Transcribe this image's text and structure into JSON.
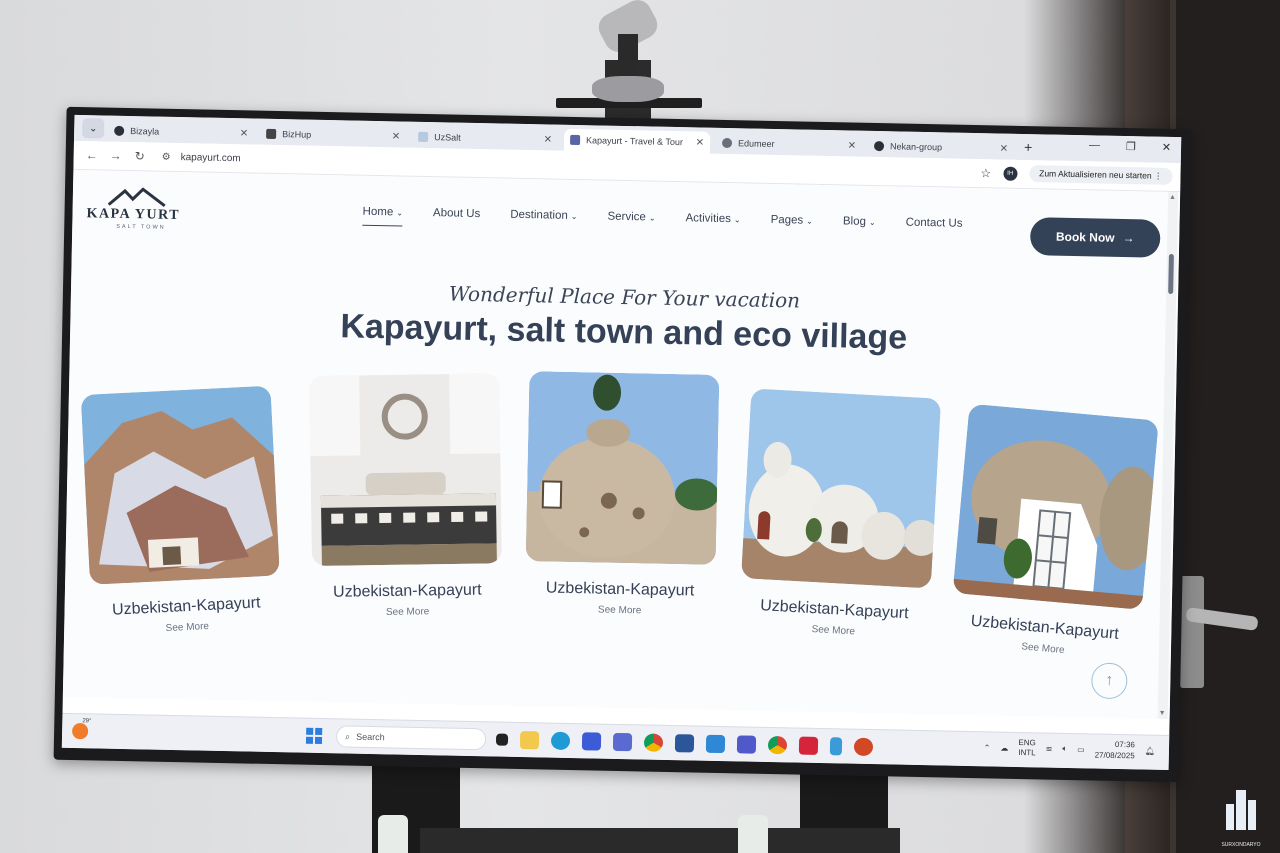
{
  "browser": {
    "tabs": [
      {
        "label": "Bizayla",
        "favicon": "bizayla-icon",
        "active": false
      },
      {
        "label": "BizHup",
        "favicon": "bizhup-icon",
        "active": false
      },
      {
        "label": "UzSalt",
        "favicon": "uzsalt-icon",
        "active": false
      },
      {
        "label": "Kapayurt - Travel & Tour",
        "favicon": "kapayurt-icon",
        "active": true
      },
      {
        "label": "Edumeer",
        "favicon": "globe-icon",
        "active": false
      },
      {
        "label": "Nekan-group",
        "favicon": "nekan-icon",
        "active": false
      }
    ],
    "url": "kapayurt.com",
    "update_button": "Zum Aktualisieren neu starten",
    "profile_badge": "IH"
  },
  "site": {
    "logo": {
      "name": "KAPA YURT",
      "sub": "SALT TOWN"
    },
    "nav": [
      {
        "label": "Home",
        "dropdown": true
      },
      {
        "label": "About Us",
        "dropdown": false
      },
      {
        "label": "Destination",
        "dropdown": true
      },
      {
        "label": "Service",
        "dropdown": true
      },
      {
        "label": "Activities",
        "dropdown": true
      },
      {
        "label": "Pages",
        "dropdown": true
      },
      {
        "label": "Blog",
        "dropdown": true
      },
      {
        "label": "Contact Us",
        "dropdown": false
      }
    ],
    "book_button": "Book Now",
    "subtitle": "Wonderful Place For Your vacation",
    "headline": "Kapayurt, salt town and eco village",
    "cards": [
      {
        "title": "Uzbekistan-Kapayurt",
        "link": "See More",
        "image": "salt-mountain-photo"
      },
      {
        "title": "Uzbekistan-Kapayurt",
        "link": "See More",
        "image": "dome-bedroom-photo"
      },
      {
        "title": "Uzbekistan-Kapayurt",
        "link": "See More",
        "image": "clay-dome-house-photo"
      },
      {
        "title": "Uzbekistan-Kapayurt",
        "link": "See More",
        "image": "white-domes-village-photo"
      },
      {
        "title": "Uzbekistan-Kapayurt",
        "link": "See More",
        "image": "dome-entrance-photo"
      }
    ]
  },
  "taskbar": {
    "weather_temp": "29°",
    "search_placeholder": "Search",
    "lang_top": "ENG",
    "lang_bottom": "INTL",
    "time": "07:36",
    "date": "27/08/2025"
  },
  "colors": {
    "primary": "#334257",
    "accent": "#6aa0bf"
  }
}
